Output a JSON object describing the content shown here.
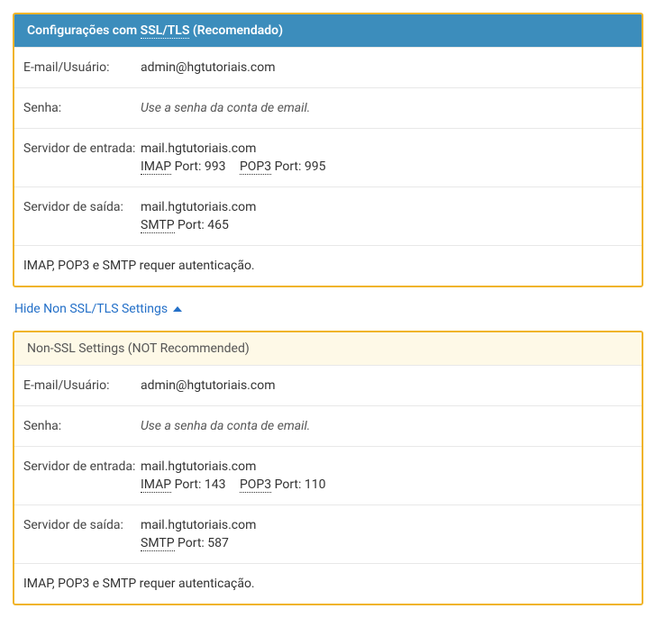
{
  "ssl_panel": {
    "header_prefix": "Configurações com ",
    "header_protocol": "SSL/TLS",
    "header_suffix": " (Recomendado)",
    "email_label": "E-mail/Usuário:",
    "email_value": "admin@hgtutoriais.com",
    "password_label": "Senha:",
    "password_value": "Use a senha da conta de email.",
    "incoming_label": "Servidor de entrada:",
    "incoming_server": "mail.hgtutoriais.com",
    "incoming_imap_proto": "IMAP",
    "incoming_imap_port_label": " Port: ",
    "incoming_imap_port": "993",
    "incoming_pop3_proto": "POP3",
    "incoming_pop3_port_label": " Port: ",
    "incoming_pop3_port": "995",
    "outgoing_label": "Servidor de saída:",
    "outgoing_server": "mail.hgtutoriais.com",
    "outgoing_smtp_proto": "SMTP",
    "outgoing_smtp_port_label": " Port: ",
    "outgoing_smtp_port": "465",
    "footer_note": "IMAP, POP3 e SMTP requer autenticação."
  },
  "toggle": {
    "label": "Hide Non SSL/TLS Settings "
  },
  "nonssl_panel": {
    "header": "Non-SSL Settings (NOT Recommended)",
    "email_label": "E-mail/Usuário:",
    "email_value": "admin@hgtutoriais.com",
    "password_label": "Senha:",
    "password_value": "Use a senha da conta de email.",
    "incoming_label": "Servidor de entrada:",
    "incoming_server": "mail.hgtutoriais.com",
    "incoming_imap_proto": "IMAP",
    "incoming_imap_port_label": " Port: ",
    "incoming_imap_port": "143",
    "incoming_pop3_proto": "POP3",
    "incoming_pop3_port_label": " Port: ",
    "incoming_pop3_port": "110",
    "outgoing_label": "Servidor de saída:",
    "outgoing_server": "mail.hgtutoriais.com",
    "outgoing_smtp_proto": "SMTP",
    "outgoing_smtp_port_label": " Port: ",
    "outgoing_smtp_port": "587",
    "footer_note": "IMAP, POP3 e SMTP requer autenticação."
  }
}
